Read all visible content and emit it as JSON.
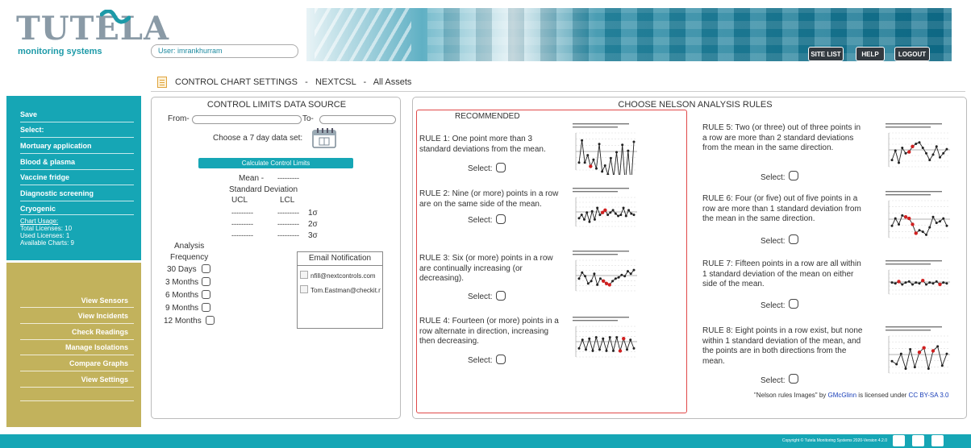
{
  "brand": {
    "name": "TUTELA",
    "tagline": "monitoring systems"
  },
  "user": {
    "prefix": "User:",
    "name": "imrankhurram"
  },
  "top_nav": {
    "site_list": "SITE LIST",
    "help": "HELP",
    "logout": "LOGOUT"
  },
  "breadcrumb": {
    "text": "CONTROL CHART SETTINGS   -   NEXTCSL   -   All Assets"
  },
  "sidebar": {
    "items": [
      "Save",
      "Select:",
      "Mortuary application",
      "Blood & plasma",
      "Vaccine fridge",
      "Diagnostic screening",
      "Cryogenic"
    ],
    "chart_usage": "Chart Usage:",
    "total_licenses": "Total Licenses: 10",
    "used_licenses": "Used Licenses: 1",
    "available_charts": "Available Charts: 9",
    "links": [
      "View Sensors",
      "View Incidents",
      "Check Readings",
      "Manage Isolations",
      "Compare Graphs",
      "View Settings"
    ]
  },
  "control_limits": {
    "title": "CONTROL LIMITS DATA SOURCE",
    "from": "From-",
    "to": "To-",
    "choose": "Choose a 7 day data set:",
    "calc_button": "Calculate Control Limits",
    "mean": "Mean -",
    "mean_val": "---------",
    "std_dev": "Standard Deviation",
    "ucl": "UCL",
    "lcl": "LCL",
    "dash": "---------",
    "sigma1": "1σ",
    "sigma2": "2σ",
    "sigma3": "3σ",
    "analysis": "Analysis",
    "frequency": "Frequency",
    "freq_options": [
      "30 Days",
      "3 Months",
      "6 Months",
      "9 Months",
      "12 Months"
    ],
    "email_title": "Email Notification",
    "emails": [
      "nfill@nextcontrols.com",
      "Tom.Eastman@checkit.n"
    ]
  },
  "nelson": {
    "title": "CHOOSE NELSON ANALYSIS RULES",
    "recommended": "RECOMMENDED",
    "select_label": "Select:",
    "rules": [
      "RULE 1: One point more than 3 standard deviations from the mean.",
      "RULE 2: Nine (or more) points in a row are on the same side of the mean.",
      "RULE 3: Six (or more) points in a row are continually increasing (or decreasing).",
      "RULE 4: Fourteen (or more) points in a row alternate in direction, increasing then decreasing.",
      "RULE 5: Two (or three) out of three points in a row are more than 2 standard deviations from the mean in the same direction.",
      "RULE 6: Four (or five) out of five points in a row are more than 1 standard deviation from the mean in the same direction.",
      "RULE 7: Fifteen points in a row are all within 1 standard deviation of the mean on either side of the mean.",
      "RULE 8: Eight points in a row exist, but none within 1 standard deviation of the mean, and the points are in both directions from the mean."
    ],
    "attribution": {
      "prefix": "\"Nelson rules Images\" by ",
      "author": "GMcGlinn",
      "middle": " is licensed under ",
      "license": "CC BY-SA 3.0"
    }
  },
  "footer": {
    "copyright": "Copyright © Tutela Monitoring Systems 2020-Version 4.2.0"
  },
  "colors": {
    "teal": "#16a6b5",
    "olive": "#c2b25c",
    "red": "#e04848",
    "link": "#1a3fb8"
  }
}
